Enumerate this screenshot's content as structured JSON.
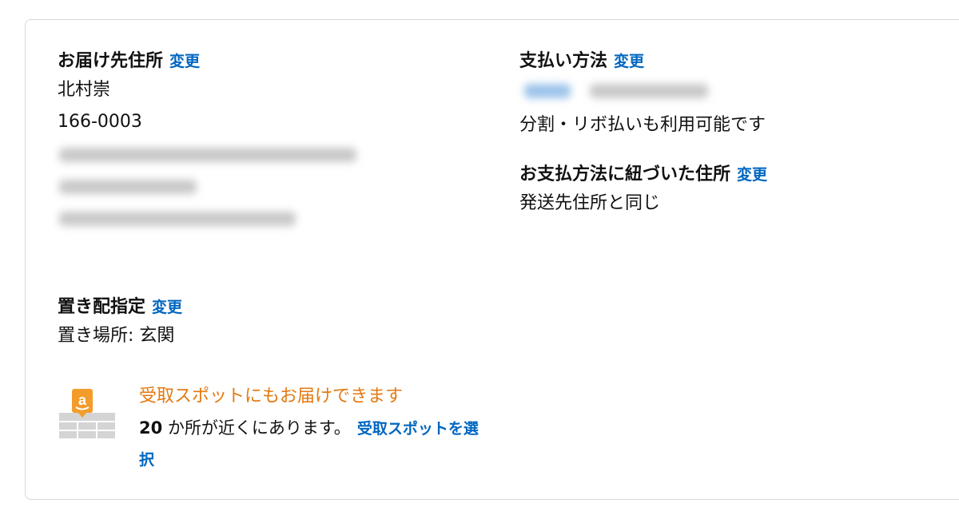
{
  "shipping": {
    "heading": "お届け先住所",
    "change_label": "変更",
    "name": "北村崇",
    "postal_code": "166-0003"
  },
  "payment": {
    "heading": "支払い方法",
    "change_label": "変更",
    "installment_note": "分割・リボ払いも利用可能です"
  },
  "billing_address": {
    "heading": "お支払方法に紐づいた住所",
    "change_label": "変更",
    "value": "発送先住所と同じ"
  },
  "delivery": {
    "heading": "置き配指定",
    "change_label": "変更",
    "location": "置き場所: 玄関"
  },
  "pickup": {
    "title": "受取スポットにもお届けできます",
    "count": "20",
    "body_suffix": " か所が近くにあります。",
    "select_link": "受取スポットを選択",
    "accent_color": "#e47911",
    "icon": "amazon-locker-icon"
  },
  "colors": {
    "link": "#0066c0",
    "border": "#d5d9d9"
  }
}
